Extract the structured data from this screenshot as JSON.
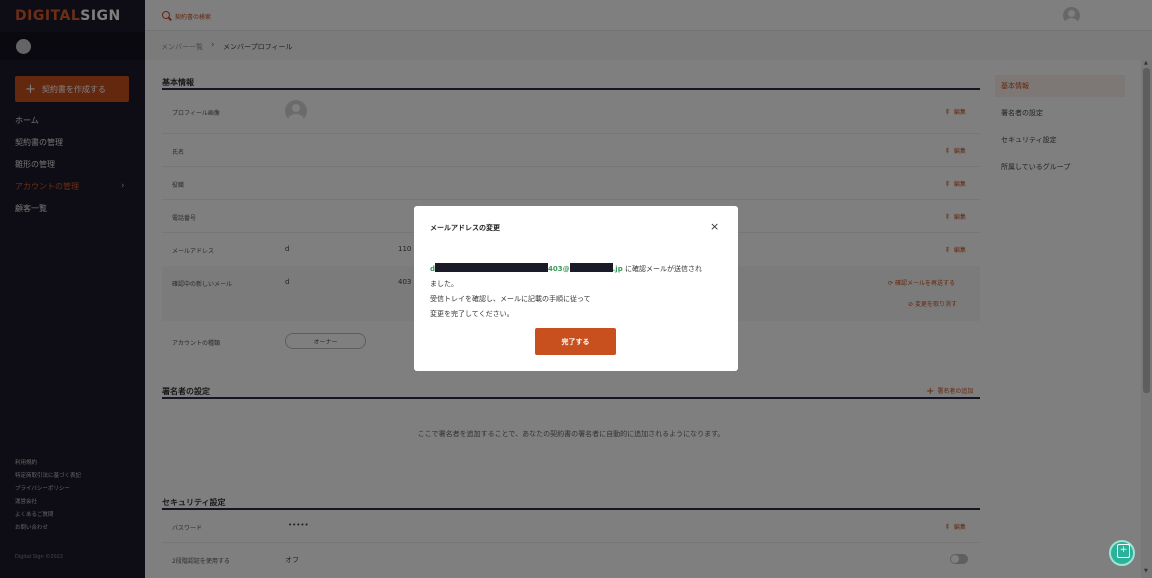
{
  "app": {
    "logo_part1": "DIGITAL",
    "logo_part2": "SIGN",
    "search_text": "契約書の検索"
  },
  "sidebar": {
    "create_button": "契約書を作成する",
    "items": [
      {
        "label": "ホーム"
      },
      {
        "label": "契約書の管理"
      },
      {
        "label": "雛形の管理"
      },
      {
        "label": "アカウントの管理"
      },
      {
        "label": "顧客一覧"
      }
    ],
    "footer_links": [
      "利用規約",
      "特定商取引法に基づく表記",
      "プライバシーポリシー",
      "運営会社",
      "よくあるご質問",
      "お問い合わせ"
    ],
    "copyright": "Digital Sign ©2022"
  },
  "breadcrumb": {
    "parent": "メンバー一覧",
    "separator": "›",
    "current": "メンバープロフィール"
  },
  "basic_info": {
    "title": "基本情報",
    "edit_label": "編集",
    "rows": {
      "profile_image": "プロフィール画像",
      "name": "氏名",
      "position": "役職",
      "phone": "電話番号",
      "email": "メールアドレス",
      "pending_email": "確認中の新しいメール",
      "account_type": "アカウントの種類"
    },
    "email_value_prefix": "d",
    "email_value_partial": "110",
    "pending_email_prefix": "d",
    "pending_email_partial": "403",
    "resend_label": "確認メールを再送する",
    "cancel_change_label": "変更を取り消す",
    "account_type_value": "オーナー"
  },
  "signer_settings": {
    "title": "署名者の設定",
    "add_label": "署名者の追加",
    "empty_message": "ここで署名者を追加することで、あなたの契約書の署名者に自動的に追加されるようになります。"
  },
  "security": {
    "title": "セキュリティ設定",
    "password_label": "パスワード",
    "password_value": "•••••",
    "two_factor_label": "2段階認証を使用する",
    "two_factor_value": "オフ",
    "edit_label": "編集"
  },
  "right_nav": {
    "items": [
      "基本情報",
      "署名者の設定",
      "セキュリティ設定",
      "所属しているグループ"
    ]
  },
  "modal": {
    "title": "メールアドレスの変更",
    "close_glyph": "×",
    "email_prefix": "d",
    "email_mid": "403@",
    "email_suffix": ".jp",
    "message_line1_tail": " に確認メールが送信され",
    "message_line2": "ました。",
    "message_line3": "受信トレイを確認し、メールに記載の手順に従って",
    "message_line4": "変更を完了してください。",
    "done_button": "完了する"
  },
  "colors": {
    "accent": "#c8501f",
    "sidebar_bg": "#1c1a2b",
    "email_green": "#3a9a5a",
    "chat_fab": "#2bb39a"
  },
  "icons": {
    "search": "search-icon",
    "chevron": "chevron-right-icon",
    "pen": "pencil-icon",
    "close": "close-icon",
    "chat": "chat-icon"
  }
}
